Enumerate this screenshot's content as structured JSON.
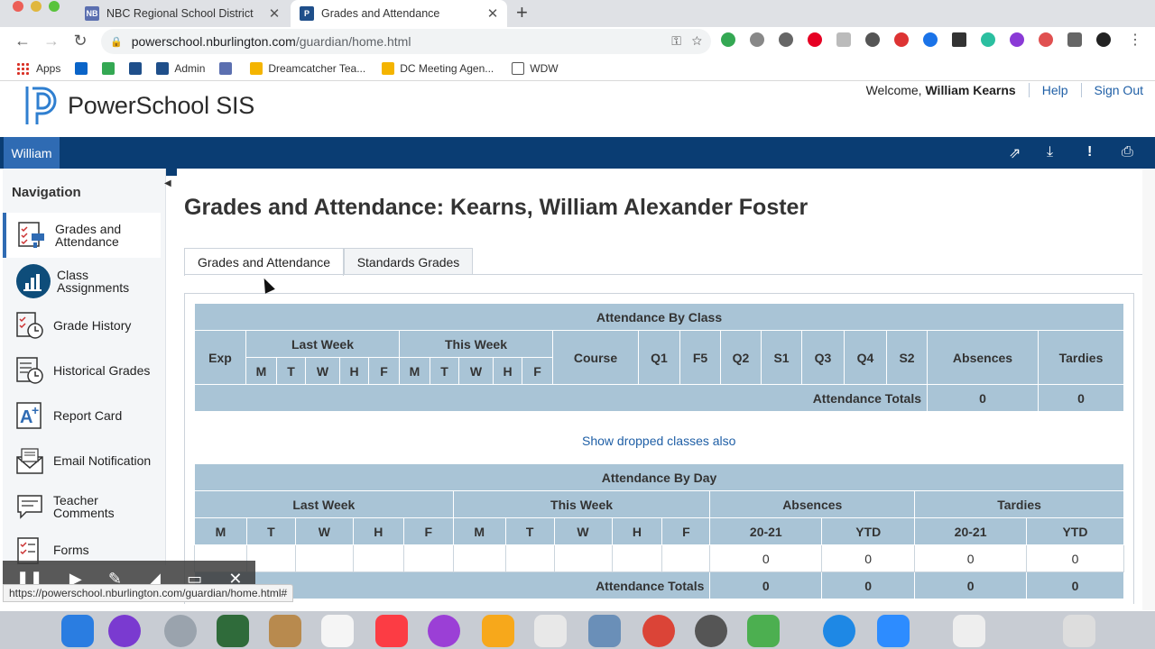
{
  "browser": {
    "tabs": [
      {
        "title": "NBC Regional School District",
        "favicon": "NB"
      },
      {
        "title": "Grades and Attendance",
        "favicon": "P"
      }
    ],
    "url_host": "powerschool.nburlington.com",
    "url_path": "/guardian/home.html",
    "bookmarks": [
      "Apps",
      "Admin",
      "Dreamcatcher Tea...",
      "DC Meeting Agen...",
      "WDW"
    ]
  },
  "header": {
    "logo_text": "PowerSchool SIS",
    "welcome_prefix": "Welcome, ",
    "user_name": "William Kearns",
    "help": "Help",
    "sign_out": "Sign Out",
    "student_tab": "William"
  },
  "navigation": {
    "heading": "Navigation",
    "items": [
      {
        "label": "Grades and Attendance",
        "icon": "grades-attendance-icon"
      },
      {
        "label": "Class Assignments",
        "icon": "class-assignments-icon"
      },
      {
        "label": "Grade History",
        "icon": "grade-history-icon"
      },
      {
        "label": "Historical Grades",
        "icon": "historical-grades-icon"
      },
      {
        "label": "Report Card",
        "icon": "report-card-icon"
      },
      {
        "label": "Email Notification",
        "icon": "email-notification-icon"
      },
      {
        "label": "Teacher Comments",
        "icon": "teacher-comments-icon"
      },
      {
        "label": "Forms",
        "icon": "forms-icon"
      }
    ]
  },
  "main": {
    "title": "Grades and Attendance: Kearns, William Alexander Foster",
    "tabs": [
      "Grades and Attendance",
      "Standards Grades"
    ],
    "by_class": {
      "caption": "Attendance By Class",
      "exp": "Exp",
      "last_week": "Last Week",
      "this_week": "This Week",
      "days": [
        "M",
        "T",
        "W",
        "H",
        "F"
      ],
      "course": "Course",
      "terms": [
        "Q1",
        "F5",
        "Q2",
        "S1",
        "Q3",
        "Q4",
        "S2"
      ],
      "absences": "Absences",
      "tardies": "Tardies",
      "totals_label": "Attendance Totals",
      "total_absences": "0",
      "total_tardies": "0"
    },
    "dropped_link": "Show dropped classes also",
    "by_day": {
      "caption": "Attendance By Day",
      "last_week": "Last Week",
      "this_week": "This Week",
      "absences": "Absences",
      "tardies": "Tardies",
      "days": [
        "M",
        "T",
        "W",
        "H",
        "F"
      ],
      "years": [
        "20-21",
        "YTD",
        "20-21",
        "YTD"
      ],
      "row_values": [
        "0",
        "0",
        "0",
        "0"
      ],
      "totals_label": "Attendance Totals",
      "totals_values": [
        "0",
        "0",
        "0",
        "0"
      ]
    }
  },
  "status_url": "https://powerschool.nburlington.com/guardian/home.html#"
}
